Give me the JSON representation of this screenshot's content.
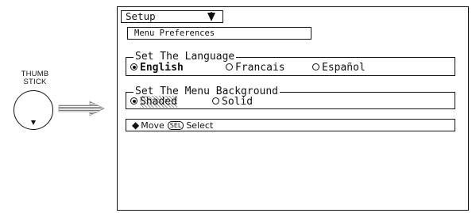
{
  "thumb_stick": {
    "label_line1": "THUMB",
    "label_line2": "STICK"
  },
  "setup": {
    "tab_label": "Setup",
    "section_label": "Menu Preferences",
    "language": {
      "title": "Set The Language",
      "options": [
        "English",
        "Francais",
        "Español"
      ],
      "selected": "English"
    },
    "background": {
      "title": "Set The Menu Background",
      "options": [
        "Shaded",
        "Solid"
      ],
      "selected": "Shaded"
    },
    "status": {
      "move_label": "Move",
      "sel_key": "SEL",
      "select_label": "Select"
    }
  }
}
